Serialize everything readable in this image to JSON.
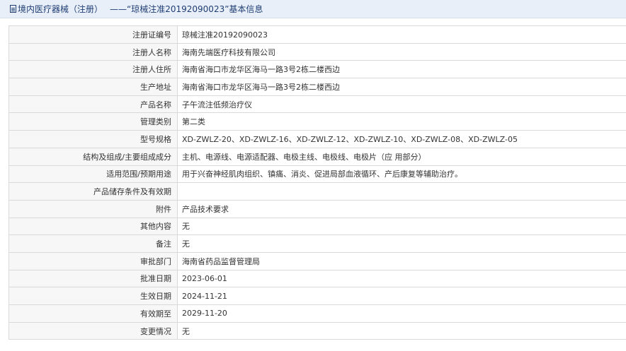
{
  "header": {
    "category": "境内医疗器械（注册）",
    "separator": "——",
    "title": "“琼械注准20192090023”基本信息"
  },
  "rows": [
    {
      "label": "注册证编号",
      "value": "琼械注准20192090023"
    },
    {
      "label": "注册人名称",
      "value": "海南先端医疗科技有限公司"
    },
    {
      "label": "注册人住所",
      "value": "海南省海口市龙华区海马一路3号2栋二楼西边"
    },
    {
      "label": "生产地址",
      "value": "海南省海口市龙华区海马一路3号2栋二楼西边"
    },
    {
      "label": "产品名称",
      "value": "子午流注低频治疗仪"
    },
    {
      "label": "管理类别",
      "value": "第二类"
    },
    {
      "label": "型号规格",
      "value": "XD-ZWLZ-20、XD-ZWLZ-16、XD-ZWLZ-12、XD-ZWLZ-10、XD-ZWLZ-08、XD-ZWLZ-05"
    },
    {
      "label": "结构及组成/主要组成成分",
      "value": "主机、电源线、电源适配器、电极主线、电极线、电极片（应 用部分）"
    },
    {
      "label": "适用范围/预期用途",
      "value": "用于兴奋神经肌肉组织、镇痛、消炎、促进局部血液循环、产后康复等辅助治疗。"
    },
    {
      "label": "产品储存条件及有效期",
      "value": ""
    },
    {
      "label": "附件",
      "value": "产品技术要求"
    },
    {
      "label": "其他内容",
      "value": "无"
    },
    {
      "label": "备注",
      "value": "无"
    },
    {
      "label": "审批部门",
      "value": "海南省药品监督管理局"
    },
    {
      "label": "批准日期",
      "value": "2023-06-01"
    },
    {
      "label": "生效日期",
      "value": "2024-11-21"
    },
    {
      "label": "有效期至",
      "value": "2029-11-20"
    },
    {
      "label": "变更情况",
      "value": "无"
    }
  ]
}
